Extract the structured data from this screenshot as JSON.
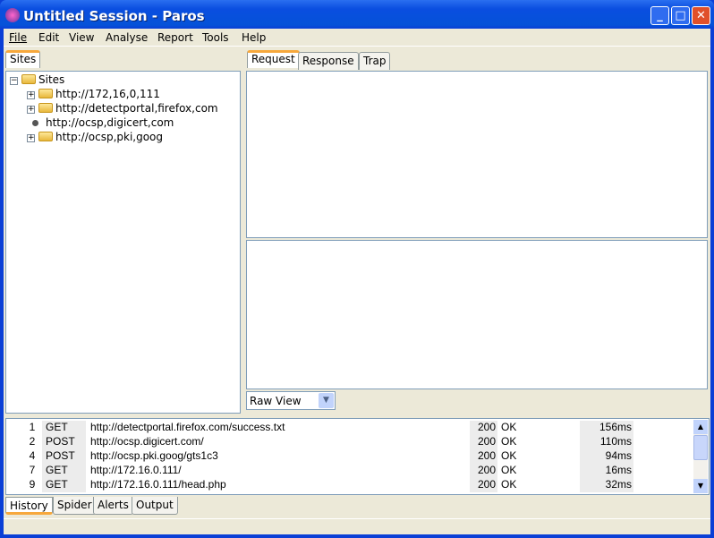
{
  "window": {
    "title": "Untitled Session - Paros",
    "minimize": "_",
    "maximize": "□",
    "close": "✕"
  },
  "menu": [
    "File",
    "Edit",
    "View",
    "Analyse",
    "Report",
    "Tools",
    "Help"
  ],
  "sites_tab": "Sites",
  "tree": {
    "root": "Sites",
    "nodes": [
      {
        "label": "http://172,16,0,111",
        "type": "folder"
      },
      {
        "label": "http://detectportal,firefox,com",
        "type": "folder"
      },
      {
        "label": "http://ocsp,digicert,com",
        "type": "leaf"
      },
      {
        "label": "http://ocsp,pki,goog",
        "type": "folder"
      }
    ]
  },
  "request_tabs": [
    "Request",
    "Response",
    "Trap"
  ],
  "view_select": "Raw View",
  "history": [
    {
      "id": "1",
      "method": "GET",
      "url": "http://detectportal.firefox.com/success.txt",
      "code": "200",
      "reason": "OK",
      "rtt": "156ms"
    },
    {
      "id": "2",
      "method": "POST",
      "url": "http://ocsp.digicert.com/",
      "code": "200",
      "reason": "OK",
      "rtt": "110ms"
    },
    {
      "id": "4",
      "method": "POST",
      "url": "http://ocsp.pki.goog/gts1c3",
      "code": "200",
      "reason": "OK",
      "rtt": "94ms"
    },
    {
      "id": "7",
      "method": "GET",
      "url": "http://172.16.0.111/",
      "code": "200",
      "reason": "OK",
      "rtt": "16ms"
    },
    {
      "id": "9",
      "method": "GET",
      "url": "http://172.16.0.111/head.php",
      "code": "200",
      "reason": "OK",
      "rtt": "32ms"
    }
  ],
  "bottom_tabs": [
    "History",
    "Spider",
    "Alerts",
    "Output"
  ]
}
